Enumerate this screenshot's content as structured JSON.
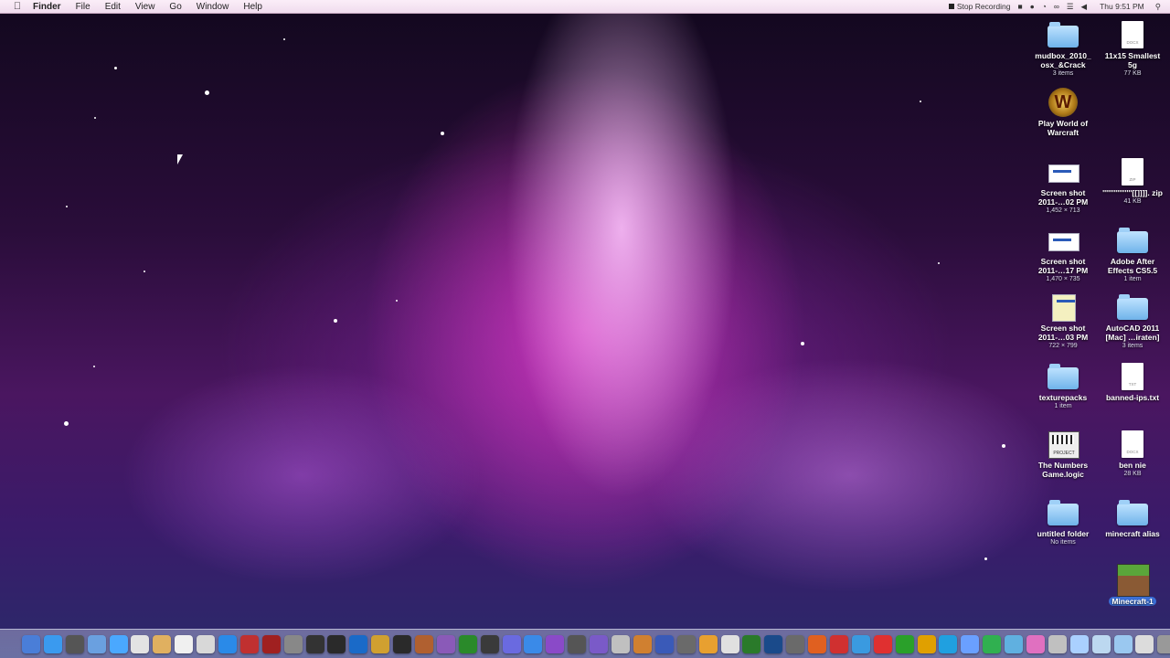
{
  "menubar": {
    "apple_icon": "apple-icon",
    "items": [
      "Finder",
      "File",
      "Edit",
      "View",
      "Go",
      "Window",
      "Help"
    ],
    "status": {
      "recording": "Stop Recording",
      "clock": "Thu 9:51 PM"
    }
  },
  "desktop_icons": [
    {
      "id": "mudbox",
      "type": "folder",
      "label": "mudbox_2010_ osx_&Crack",
      "sub": "3 items"
    },
    {
      "id": "smallest",
      "type": "doc",
      "ext": "DOCX",
      "label": "11x15 Smallest 5g",
      "sub": "77 KB"
    },
    {
      "id": "wow",
      "type": "wow",
      "label": "Play World of Warcraft",
      "sub": ""
    },
    {
      "id": "shot1",
      "type": "shot",
      "label": "Screen shot 2011-…02 PM",
      "sub": "1,452 × 713"
    },
    {
      "id": "zip",
      "type": "doc",
      "ext": "ZIP",
      "label": "''''''''''''''''[[]]]]. zip",
      "sub": "41 KB"
    },
    {
      "id": "shot2",
      "type": "shot",
      "label": "Screen shot 2011-…17 PM",
      "sub": "1,470 × 735"
    },
    {
      "id": "aftereffects",
      "type": "folder",
      "label": "Adobe After Effects CS5.5",
      "sub": "1 item"
    },
    {
      "id": "shot3",
      "type": "shot",
      "label": "Screen shot 2011-…03 PM",
      "sub": "722 × 799"
    },
    {
      "id": "autocad",
      "type": "folder",
      "label": "AutoCAD 2011 [Mac] …iraten]",
      "sub": "3 items"
    },
    {
      "id": "texturepacks",
      "type": "folder",
      "label": "texturepacks",
      "sub": "1 item"
    },
    {
      "id": "banned",
      "type": "doc",
      "ext": "TXT",
      "label": "banned-ips.txt",
      "sub": ""
    },
    {
      "id": "numbers",
      "type": "logic",
      "label": "The Numbers Game.logic",
      "sub": ""
    },
    {
      "id": "bennie",
      "type": "doc",
      "ext": "DOCX",
      "label": "ben nie",
      "sub": "28 KB"
    },
    {
      "id": "untitled",
      "type": "folder",
      "label": "untitled folder",
      "sub": "No items"
    },
    {
      "id": "minecraft_alias",
      "type": "folder",
      "label": "minecraft alias",
      "sub": ""
    },
    {
      "id": "minecraft1",
      "type": "mc",
      "label": "Minecraft-1",
      "sub": ""
    }
  ],
  "dock": {
    "colors": [
      "#4a7ed8",
      "#3a9aef",
      "#555",
      "#6aa0e0",
      "#4aa8ff",
      "#e3e3e3",
      "#e0b060",
      "#f0f0f0",
      "#d8d8d8",
      "#2a8ae8",
      "#c03030",
      "#a02020",
      "#888",
      "#333",
      "#2a2a2a",
      "#1a6ac8",
      "#d0a030",
      "#2a2a2a",
      "#b06030",
      "#8a5ab8",
      "#2a8a2a",
      "#3a3a3a",
      "#6a6ae0",
      "#3a8ae8",
      "#8a4ac8",
      "#555",
      "#7a5ac8",
      "#c0c0c0",
      "#d08030",
      "#3a5ab8",
      "#6a6a6a",
      "#e8a030",
      "#e0e0e0",
      "#2a7a2a",
      "#1a4a8a",
      "#6a6a6a",
      "#e06020",
      "#d03030",
      "#3a9ae0",
      "#e03030",
      "#2aa02a",
      "#e0a000",
      "#20a0e0",
      "#6aa0ff",
      "#30b050",
      "#60b0e0",
      "#e070c0",
      "#c0c0c0",
      "#aad0ff",
      "#bcd8f0",
      "#9ac8f0",
      "#dcdcdc",
      "#999"
    ]
  }
}
